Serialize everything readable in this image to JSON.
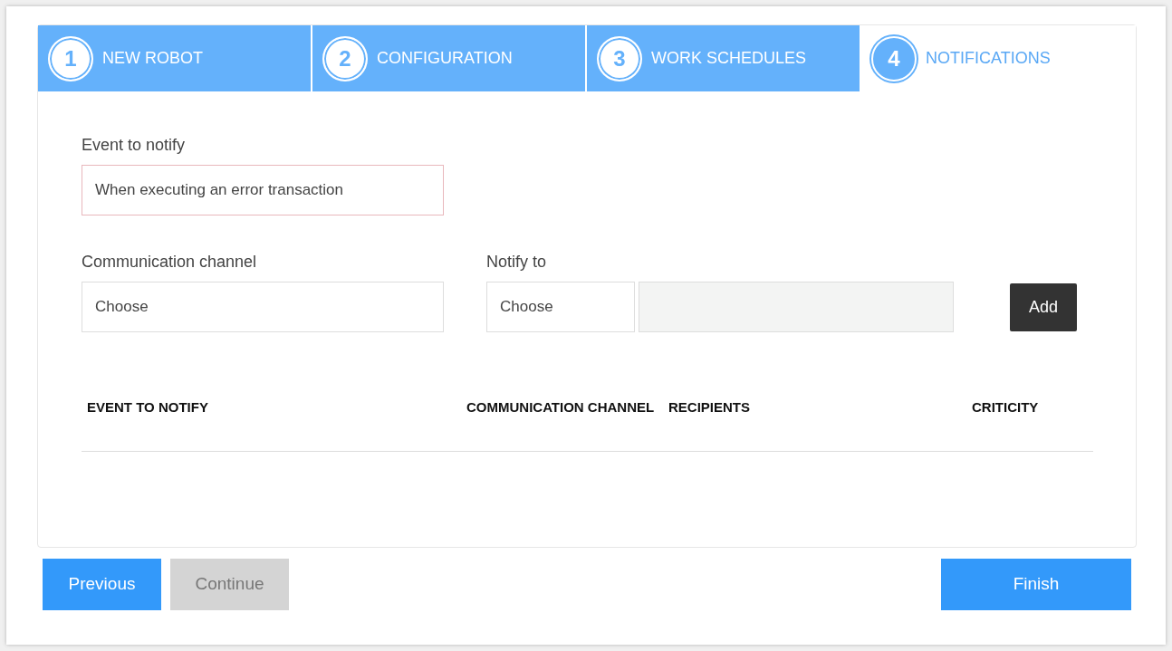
{
  "steps": [
    {
      "number": "1",
      "label": "NEW ROBOT",
      "selected": false
    },
    {
      "number": "2",
      "label": "CONFIGURATION",
      "selected": false
    },
    {
      "number": "3",
      "label": "WORK SCHEDULES",
      "selected": false
    },
    {
      "number": "4",
      "label": "NOTIFICATIONS",
      "selected": true
    }
  ],
  "event_field": {
    "label": "Event to notify",
    "value": "When executing an error transaction"
  },
  "channel_field": {
    "label": "Communication channel",
    "value": "Choose"
  },
  "notify_field": {
    "label": "Notify to",
    "value": "Choose"
  },
  "recipients_field": {
    "disabled": true
  },
  "add_button": "Add",
  "table": {
    "columns": [
      "EVENT TO NOTIFY",
      "COMMUNICATION CHANNEL",
      "RECIPIENTS",
      "CRITICITY"
    ]
  },
  "buttons": [
    {
      "label": "Previous",
      "disabled": false
    },
    {
      "label": "Continue",
      "disabled": true
    },
    {
      "label": "Finish",
      "disabled": false
    }
  ]
}
